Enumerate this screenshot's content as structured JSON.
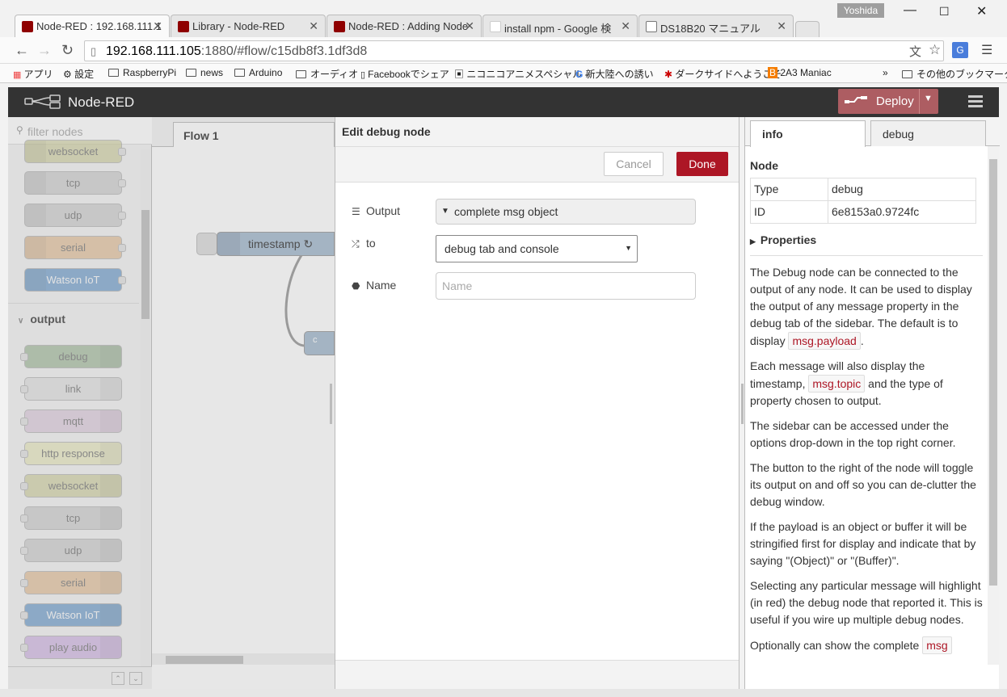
{
  "browser": {
    "tabs": [
      {
        "title": "Node-RED : 192.168.111.1",
        "icon": "node-red"
      },
      {
        "title": "Library - Node-RED",
        "icon": "node-red"
      },
      {
        "title": "Node-RED : Adding Node",
        "icon": "node-red"
      },
      {
        "title": "install   npm - Google 検",
        "icon": "google"
      },
      {
        "title": "DS18B20 マニュアル",
        "icon": "document"
      }
    ],
    "user": "Yoshida",
    "url_host": "192.168.111.105",
    "url_rest": ":1880/#flow/c15db8f3.1df3d8",
    "bookmarks": [
      "アプリ",
      "設定",
      "RaspberryPi",
      "news",
      "Arduino",
      "オーディオ",
      "Facebookでシェア",
      "ニコニコアニメスペシャル -",
      "新大陸への誘い",
      "ダークサイドへようこそ",
      "2A3 Maniac",
      "その他のブックマーク"
    ]
  },
  "header": {
    "title": "Node-RED",
    "deploy_label": "Deploy"
  },
  "palette": {
    "filter_placeholder": "filter nodes",
    "input_nodes": [
      "websocket",
      "tcp",
      "udp",
      "serial",
      "Watson IoT"
    ],
    "output_category": "output",
    "output_nodes": [
      "debug",
      "link",
      "mqtt",
      "http response",
      "websocket",
      "tcp",
      "udp",
      "serial",
      "Watson IoT",
      "play audio"
    ],
    "colors": {
      "blue": "#3FADB5",
      "grey": "#c0c0c0",
      "purple": "#d8bfd8",
      "sand": "#dbd27f",
      "orange": "#e7b06a",
      "iot": "#0a6ebd",
      "violet": "#c6a0e0",
      "debug": "#87a980"
    }
  },
  "workspace": {
    "tab": "Flow 1",
    "node_label": "timestamp ↻",
    "node2_label": "c"
  },
  "tray": {
    "title": "Edit debug node",
    "cancel": "Cancel",
    "done": "Done",
    "output_label": "Output",
    "output_value": "complete msg object",
    "to_label": "to",
    "to_value": "debug tab and console",
    "name_label": "Name",
    "name_placeholder": "Name"
  },
  "sidebar": {
    "tab_info": "info",
    "tab_debug": "debug",
    "section": "Node",
    "rows": [
      {
        "key": "Type",
        "value": "debug"
      },
      {
        "key": "ID",
        "value": "6e8153a0.9724fc"
      }
    ],
    "properties": "Properties",
    "p1a": "The Debug node can be connected to the output of any node. It can be used to display the output of any message property in the debug tab of the sidebar. The default is to display ",
    "p1code": "msg.payload",
    "p1b": ".",
    "p2a": "Each message will also display the timestamp, ",
    "p2code": "msg.topic",
    "p2b": " and the type of property chosen to output.",
    "p3": "The sidebar can be accessed under the options drop-down in the top right corner.",
    "p4": "The button to the right of the node will toggle its output on and off so you can de-clutter the debug window.",
    "p5": "If the payload is an object or buffer it will be stringified first for display and indicate that by saying \"(Object)\" or \"(Buffer)\".",
    "p6": "Selecting any particular message will highlight (in red) the debug node that reported it. This is useful if you wire up multiple debug nodes.",
    "p7a": "Optionally can show the complete ",
    "p7code": "msg"
  }
}
